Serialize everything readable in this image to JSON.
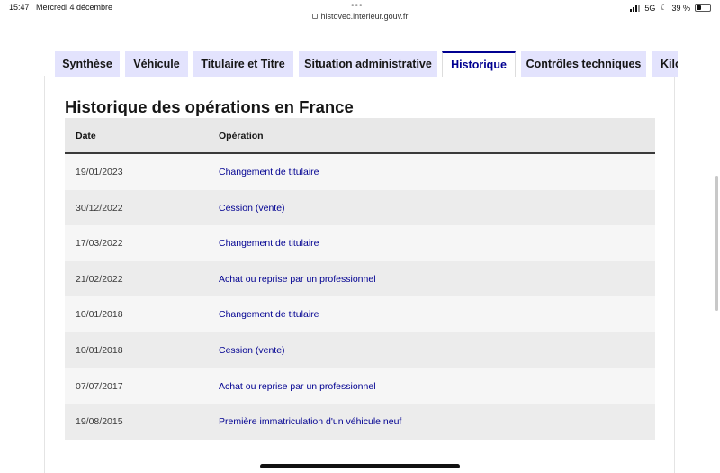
{
  "status_bar": {
    "time": "15:47",
    "date": "Mercredi 4 décembre",
    "dots": "•••",
    "url": "histovec.interieur.gouv.fr",
    "network": "5G",
    "battery_text": "39 %",
    "battery_level": 0.39
  },
  "tabs": [
    {
      "label": "Synthèse",
      "active": false
    },
    {
      "label": "Véhicule",
      "active": false
    },
    {
      "label": "Titulaire et Titre",
      "active": false
    },
    {
      "label": "Situation administrative",
      "active": false
    },
    {
      "label": "Historique",
      "active": true
    },
    {
      "label": "Contrôles techniques",
      "active": false
    },
    {
      "label": "Kilo",
      "active": false
    }
  ],
  "page": {
    "title": "Historique des opérations en France"
  },
  "table": {
    "headers": [
      "Date",
      "Opération"
    ],
    "rows": [
      {
        "date": "19/01/2023",
        "operation": "Changement de titulaire"
      },
      {
        "date": "30/12/2022",
        "operation": "Cession (vente)"
      },
      {
        "date": "17/03/2022",
        "operation": "Changement de titulaire"
      },
      {
        "date": "21/02/2022",
        "operation": "Achat ou reprise par un professionnel"
      },
      {
        "date": "10/01/2018",
        "operation": "Changement de titulaire"
      },
      {
        "date": "10/01/2018",
        "operation": "Cession (vente)"
      },
      {
        "date": "07/07/2017",
        "operation": "Achat ou reprise par un professionnel"
      },
      {
        "date": "19/08/2015",
        "operation": "Première immatriculation d'un véhicule neuf"
      }
    ]
  },
  "colors": {
    "accent": "#000091",
    "tab_background": "#e3e3fd",
    "header_background": "#e8e8e8"
  }
}
